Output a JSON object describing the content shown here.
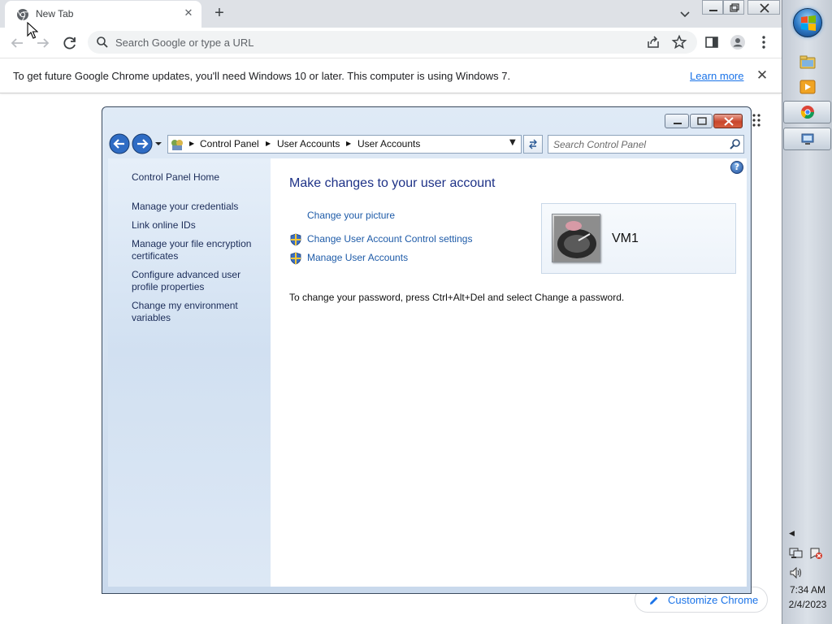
{
  "browser": {
    "tab": {
      "title": "New Tab"
    },
    "omnibox": {
      "placeholder": "Search Google or type a URL"
    },
    "infobar": {
      "message": "To get future Google Chrome updates, you'll need Windows 10 or later. This computer is using Windows 7.",
      "link": "Learn more"
    },
    "customize_label": "Customize Chrome"
  },
  "control_panel": {
    "breadcrumb": [
      "Control Panel",
      "User Accounts",
      "User Accounts"
    ],
    "search_placeholder": "Search Control Panel",
    "left_links": [
      "Control Panel Home",
      "Manage your credentials",
      "Link online IDs",
      "Manage your file encryption certificates",
      "Configure advanced user profile properties",
      "Change my environment variables"
    ],
    "heading": "Make changes to your user account",
    "tasks": [
      {
        "label": "Change your picture",
        "shield": false
      },
      {
        "label": "Change User Account Control settings",
        "shield": true
      },
      {
        "label": "Manage User Accounts",
        "shield": true
      }
    ],
    "note": "To change your password, press Ctrl+Alt+Del and select Change a password.",
    "user": {
      "name": "VM1"
    },
    "help_label": "?"
  },
  "taskbar": {
    "clock": {
      "time": "7:34 AM",
      "date": "2/4/2023"
    }
  },
  "icons": {
    "tab": "chrome-icon",
    "tray": [
      "network-icon",
      "action-center-icon",
      "volume-icon"
    ]
  },
  "colors": {
    "link_blue": "#1a73e8",
    "cp_heading": "#1e3287",
    "cp_link": "#1e5ba8"
  }
}
